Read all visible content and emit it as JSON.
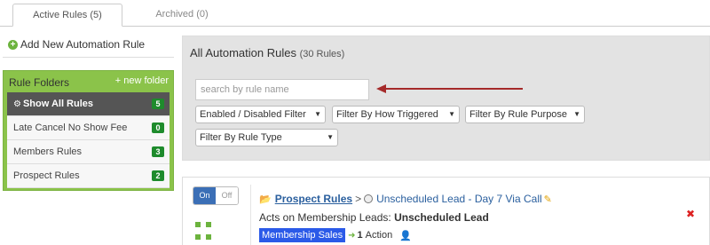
{
  "tabs": [
    {
      "label": "Active Rules (5)",
      "active": true
    },
    {
      "label": "Archived (0)",
      "active": false
    }
  ],
  "sidebar": {
    "add_rule_label": "Add New Automation Rule",
    "folders_title": "Rule Folders",
    "new_folder_label": "+ new folder",
    "folders": [
      {
        "label": "Show All Rules",
        "count": "5",
        "active": true
      },
      {
        "label": "Late Cancel No Show Fee",
        "count": "0",
        "active": false
      },
      {
        "label": "Members Rules",
        "count": "3",
        "active": false
      },
      {
        "label": "Prospect Rules",
        "count": "2",
        "active": false
      }
    ]
  },
  "main": {
    "title": "All Automation Rules",
    "title_count": "(30 Rules)",
    "search_placeholder": "search by rule name",
    "filters": [
      "Enabled / Disabled Filter",
      "Filter By How Triggered",
      "Filter By Rule Purpose",
      "Filter By Rule Type"
    ]
  },
  "rule": {
    "toggle_on": "On",
    "toggle_off": "Off",
    "folder_link": "Prospect Rules",
    "separator": ">",
    "rule_name": "Unscheduled Lead - Day 7 Via Call",
    "acts_prefix": "Acts on Membership Leads:",
    "acts_target": "Unscheduled Lead",
    "badge": "Membership Sales",
    "action_count": "1",
    "action_label": "Action"
  },
  "colors": {
    "folder_green": "#8bc34a",
    "count_badge": "#1e8b2c",
    "link_blue": "#2a5f9e",
    "badge_blue": "#2b5ae8",
    "toggle_on": "#3b6fb6",
    "annotation_arrow": "#a52a2a"
  }
}
